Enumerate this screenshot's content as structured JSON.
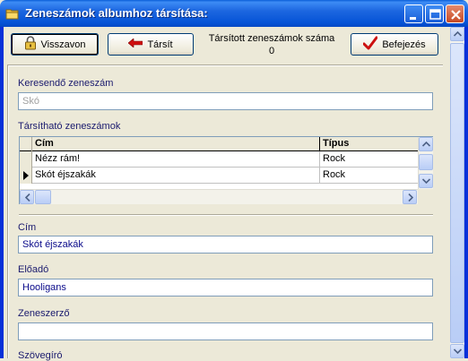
{
  "window": {
    "title": "Zeneszámok albumhoz társítása:"
  },
  "toolbar": {
    "back_label": "Visszavon",
    "associate_label": "Társít",
    "counter_label": "Társított zeneszámok száma",
    "counter_value": "0",
    "finish_label": "Befejezés"
  },
  "search": {
    "label": "Keresendő zeneszám",
    "placeholder": "Skó"
  },
  "grid": {
    "label": "Társítható zeneszámok",
    "columns": [
      "Cím",
      "Típus"
    ],
    "rows": [
      {
        "title": "Nézz rám!",
        "type": "Rock",
        "selected": false
      },
      {
        "title": "Skót éjszakák",
        "type": "Rock",
        "selected": true
      }
    ]
  },
  "details": {
    "title_label": "Cím",
    "title_value": "Skót éjszakák",
    "performer_label": "Előadó",
    "performer_value": "Hooligans",
    "composer_label": "Zeneszerző",
    "composer_value": "",
    "lyricist_label": "Szövegíró"
  },
  "colors": {
    "titlebar": "#0553d6",
    "label_text": "#1a1a6e",
    "field_text": "#0a0a8a",
    "arrow_red": "#d01010",
    "checkmark_red": "#cc1010"
  },
  "icons": {
    "window": "folder-icon",
    "back": "lock-icon",
    "associate": "left-arrow-icon",
    "finish": "checkmark-icon"
  }
}
